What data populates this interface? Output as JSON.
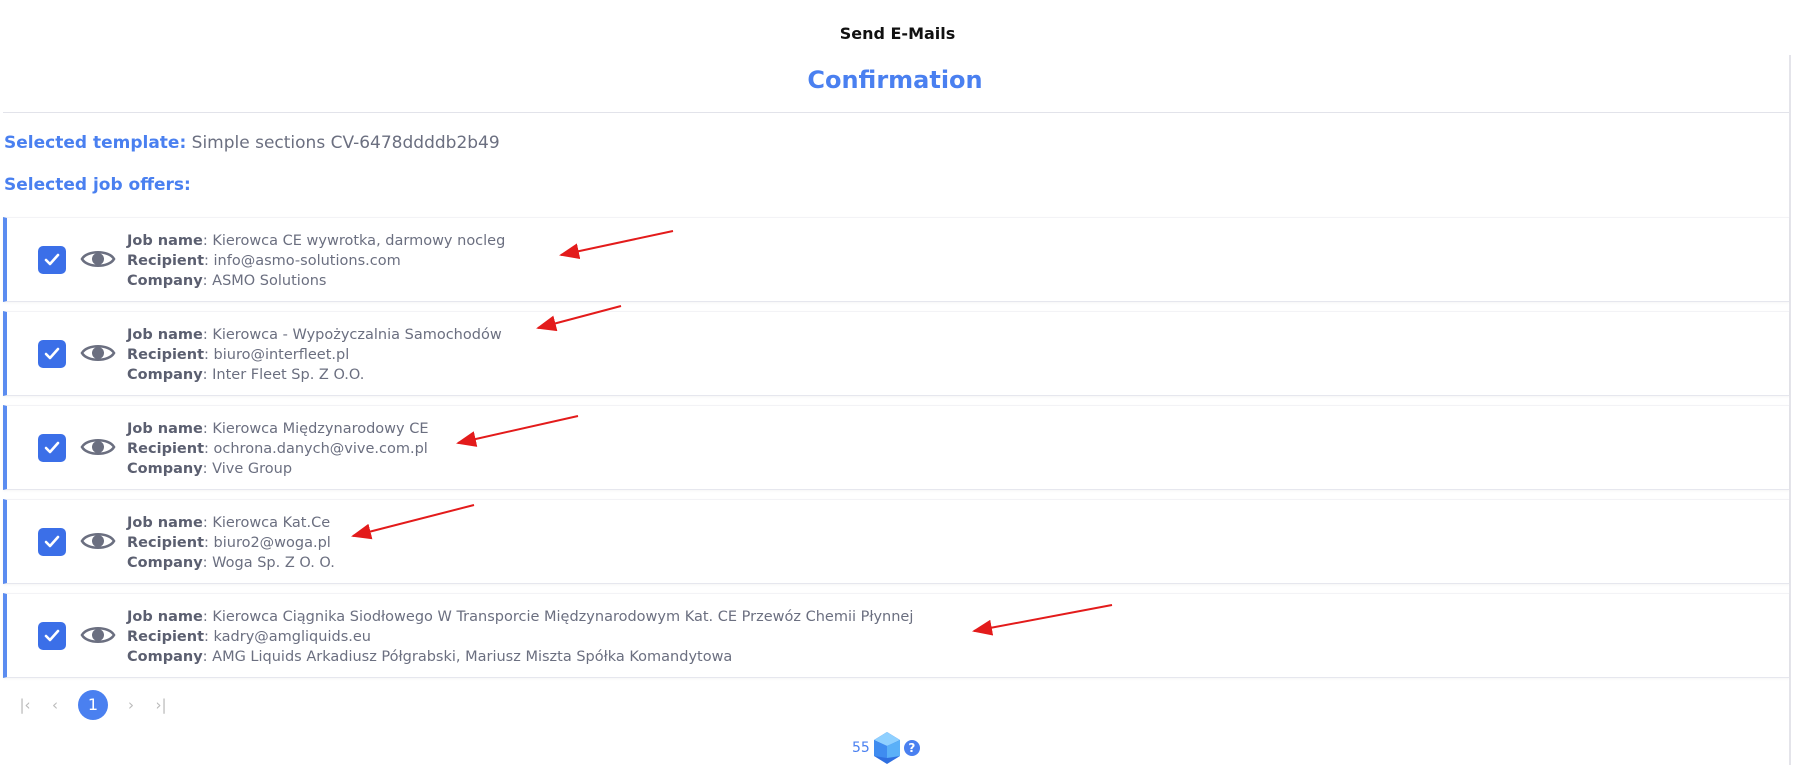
{
  "header": {
    "title": "Send E-Mails",
    "subtitle": "Confirmation"
  },
  "template": {
    "label": "Selected template:",
    "value": "Simple sections CV-6478ddddb2b49"
  },
  "offers_label": "Selected job offers:",
  "field_labels": {
    "job": "Job name",
    "recipient": "Recipient",
    "company": "Company"
  },
  "offers": [
    {
      "checked": true,
      "job": "Kierowca CE wywrotka, darmowy nocleg",
      "recipient": "info@asmo-solutions.com",
      "company": "ASMO Solutions"
    },
    {
      "checked": true,
      "job": "Kierowca - Wypożyczalnia Samochodów",
      "recipient": "biuro@interfleet.pl",
      "company": "Inter Fleet Sp. Z O.O."
    },
    {
      "checked": true,
      "job": "Kierowca Międzynarodowy CE",
      "recipient": "ochrona.danych@vive.com.pl",
      "company": "Vive Group"
    },
    {
      "checked": true,
      "job": "Kierowca Kat.Ce",
      "recipient": "biuro2@woga.pl",
      "company": "Woga Sp. Z O. O."
    },
    {
      "checked": true,
      "job": "Kierowca Ciągnika Siodłowego W Transporcie Międzynarodowym Kat. CE Przewóz Chemii Płynnej",
      "recipient": "kadry@amgliquids.eu",
      "company": "AMG Liquids Arkadiusz Półgrabski, Mariusz Miszta Spółka Komandytowa"
    }
  ],
  "pagination": {
    "first": "|‹",
    "prev": "‹",
    "current": "1",
    "next": "›",
    "last": "›|"
  },
  "footer": {
    "credits": "55",
    "help": "?"
  },
  "colors": {
    "accent": "#4a80f0",
    "arrow": "#e31b1b"
  }
}
